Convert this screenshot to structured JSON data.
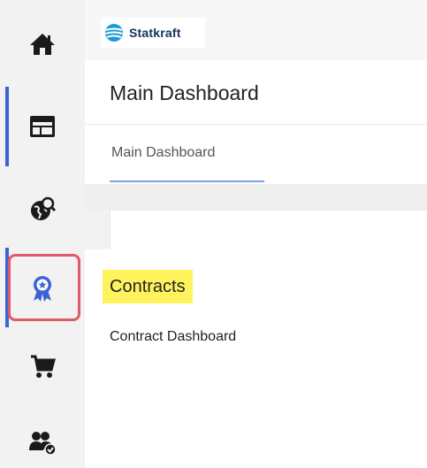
{
  "brand": {
    "name": "Statkraft"
  },
  "page": {
    "title": "Main Dashboard"
  },
  "tabs": [
    {
      "label": "Main Dashboard",
      "active": true
    }
  ],
  "section": {
    "heading": "Contracts",
    "item": "Contract Dashboard"
  },
  "sidebar": {
    "items": [
      {
        "icon": "home-icon"
      },
      {
        "icon": "dashboard-icon",
        "active": true
      },
      {
        "icon": "globe-search-icon"
      },
      {
        "icon": "award-badge-icon",
        "highlighted": true
      },
      {
        "icon": "cart-icon"
      },
      {
        "icon": "users-check-icon"
      }
    ]
  },
  "colors": {
    "accent": "#3b63d6",
    "highlight": "#fef35c",
    "annotation": "#e05a67",
    "brand": "#12325c"
  }
}
